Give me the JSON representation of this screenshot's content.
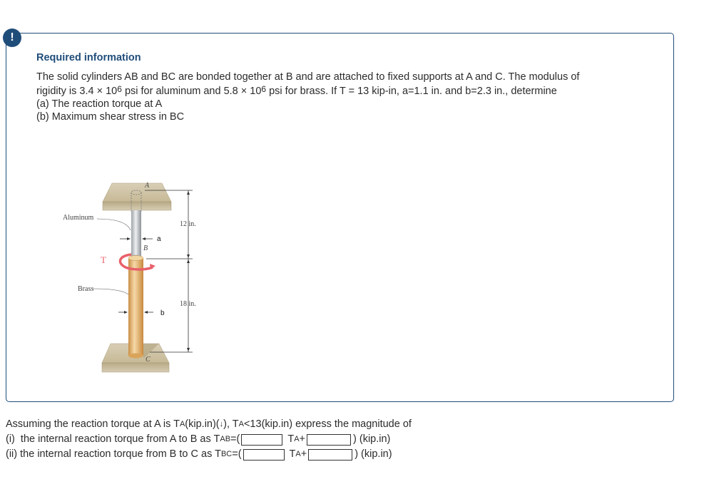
{
  "badge": {
    "icon": "exclamation-icon",
    "glyph": "!"
  },
  "info": {
    "heading": "Required information",
    "line1": "The solid cylinders AB and BC are bonded together at B and are attached to fixed supports at A and C. The modulus of",
    "line2_a": "rigidity is 3.4 × 10",
    "line2_exp1": "6",
    "line2_b": " psi for aluminum and 5.8 × 10",
    "line2_exp2": "6",
    "line2_c": " psi for brass. If T = 13 kip-in, a=1.1 in. and b=2.3 in., determine",
    "part_a": "(a) The reaction torque at A",
    "part_b": "(b) Maximum shear stress in BC"
  },
  "figure": {
    "label_A": "A",
    "label_B": "B",
    "label_C": "C",
    "label_T": "T",
    "label_aluminum": "Aluminum",
    "label_brass": "Brass",
    "label_a": "a",
    "label_b": "b",
    "dim_top": "12 in.",
    "dim_bottom": "18 in.",
    "colors": {
      "aluminum": "#c9cccf",
      "brass": "#e0b070",
      "support": "#d8ccb0",
      "torque_arrow": "#e8606a"
    }
  },
  "question": {
    "intro_a": "Assuming the reaction torque at A is T",
    "intro_sub1": "A",
    "intro_b": " (kip.in)(",
    "intro_arrow": "↓",
    "intro_c": "), T",
    "intro_sub2": "A",
    "intro_d": "<13(kip.in) express the magnitude of",
    "rows": [
      {
        "prefix": "(i)  the internal reaction torque from A to B as T",
        "sub": "AB",
        "eq": "=(",
        "ta": "T",
        "ta_sub": "A",
        "plus": "+",
        "unit": ") (kip.in)",
        "coef_value": "",
        "const_value": ""
      },
      {
        "prefix": "(ii) the internal reaction torque from B to C as T",
        "sub": "BC",
        "eq": "=(",
        "ta": "T",
        "ta_sub": "A",
        "plus": "+",
        "unit": ") (kip.in)",
        "coef_value": "",
        "const_value": ""
      }
    ]
  }
}
